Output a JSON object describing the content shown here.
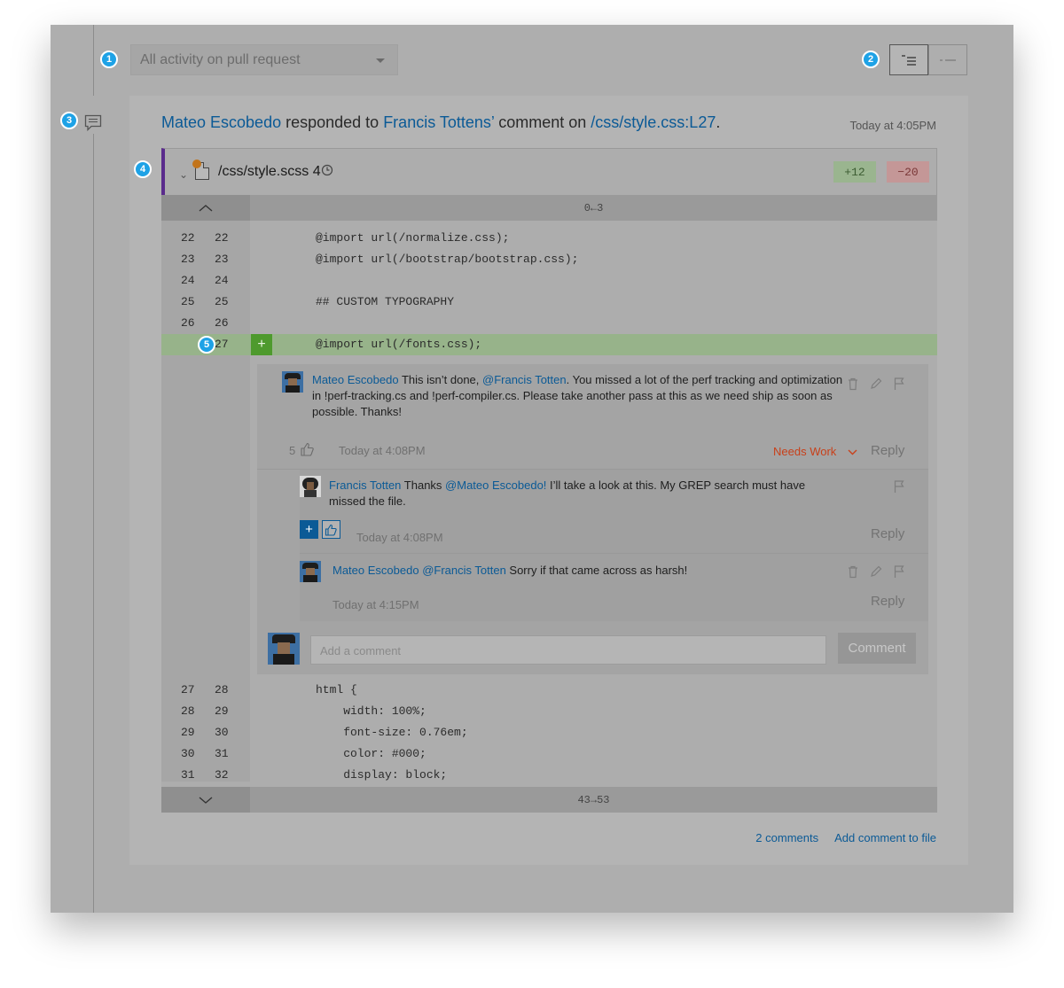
{
  "filter": {
    "label": "All activity on pull request"
  },
  "callouts": [
    "1",
    "2",
    "3",
    "4",
    "5"
  ],
  "headline": {
    "author": "Mateo Escobedo",
    "verb": " responded to ",
    "target": "Francis Tottens’",
    "mid": " comment on ",
    "path": "/css/style.css:L27",
    "end": ".",
    "time": "Today at 4:05PM"
  },
  "file": {
    "name": "/css/style.scss",
    "history_count": "4",
    "additions": "+12",
    "deletions": "−20",
    "top_range": "0←3",
    "bottom_range": "43→53"
  },
  "lines_before": [
    {
      "old": "22",
      "new": "22",
      "code": "@import url(/normalize.css);"
    },
    {
      "old": "23",
      "new": "23",
      "code": "@import url(/bootstrap/bootstrap.css);"
    },
    {
      "old": "24",
      "new": "24",
      "code": ""
    },
    {
      "old": "25",
      "new": "25",
      "code": "## CUSTOM TYPOGRAPHY"
    },
    {
      "old": "26",
      "new": "26",
      "code": ""
    }
  ],
  "added_line": {
    "new": "27",
    "mark": "+",
    "code": "@import url(/fonts.css);"
  },
  "lines_after": [
    {
      "old": "27",
      "new": "28",
      "code": "html {"
    },
    {
      "old": "28",
      "new": "29",
      "code": "    width: 100%;"
    },
    {
      "old": "29",
      "new": "30",
      "code": "    font-size: 0.76em;"
    },
    {
      "old": "30",
      "new": "31",
      "code": "    color: #000;"
    },
    {
      "old": "31",
      "new": "32",
      "code": "    display: block;"
    }
  ],
  "comments": {
    "c1": {
      "author": "Mateo Escobedo",
      "text_a": " This isn’t done, ",
      "mention": "@Francis Totten",
      "text_b": ". You missed a lot of the perf tracking and optimization in !perf-tracking.cs and !perf-compiler.cs. Please take another pass at this as we need ship as soon as possible. Thanks!",
      "likes": "5",
      "time": "Today at 4:08PM",
      "status": "Needs Work",
      "reply": "Reply"
    },
    "c2": {
      "author": "Francis Totten",
      "text_a": " Thanks ",
      "mention": "@Mateo Escobedo!",
      "text_b": " I’ll take a look at this. My GREP search must have missed the file.",
      "plus": "+",
      "time": "Today at 4:08PM",
      "reply": "Reply"
    },
    "c3": {
      "author": "Mateo Escobedo",
      "mention": " @Francis Totten",
      "text_b": " Sorry if that came across as harsh!",
      "time": "Today at 4:15PM",
      "reply": "Reply"
    }
  },
  "composer": {
    "placeholder": "Add a comment",
    "button": "Comment"
  },
  "footer": {
    "comments_link": "2 comments",
    "add_link": "Add comment to file"
  },
  "colors": {
    "link": "#0b5a96",
    "accent_bar": "#5a2b8c",
    "added_bg": "#97b38a",
    "status": "#c8401a",
    "callout": "#1ea2e6"
  }
}
